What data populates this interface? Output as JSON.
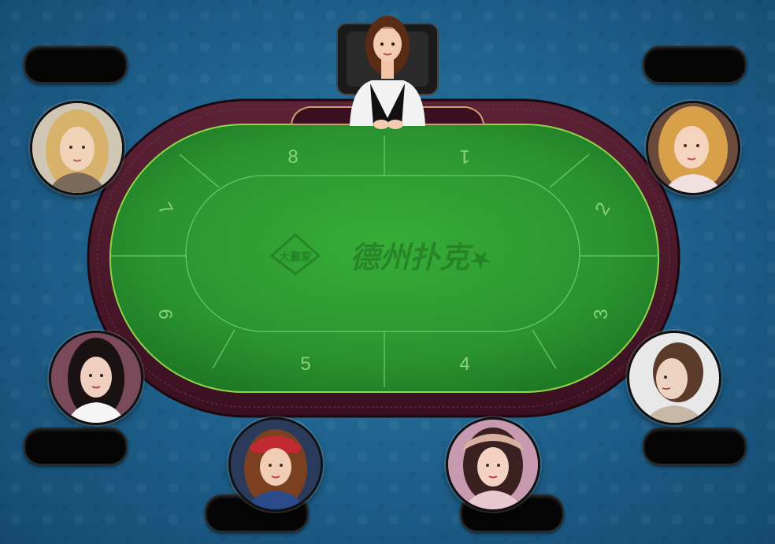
{
  "table": {
    "seat_numbers": [
      "8",
      "1",
      "2",
      "3",
      "4",
      "5",
      "6",
      "7"
    ],
    "logo_badge": "大赢家",
    "logo_text": "德州扑克",
    "felt_color": "#2e9a2e",
    "rail_color": "#4a1a2a"
  },
  "dealer": {
    "icon": "dealer-avatar"
  },
  "seats": [
    {
      "id": "seat-top-left",
      "name": ""
    },
    {
      "id": "seat-top-right",
      "name": ""
    },
    {
      "id": "seat-bottom-left",
      "name": ""
    },
    {
      "id": "seat-bottom-right",
      "name": ""
    },
    {
      "id": "seat-bottom-center-left",
      "name": ""
    },
    {
      "id": "seat-bottom-center-right",
      "name": ""
    }
  ]
}
